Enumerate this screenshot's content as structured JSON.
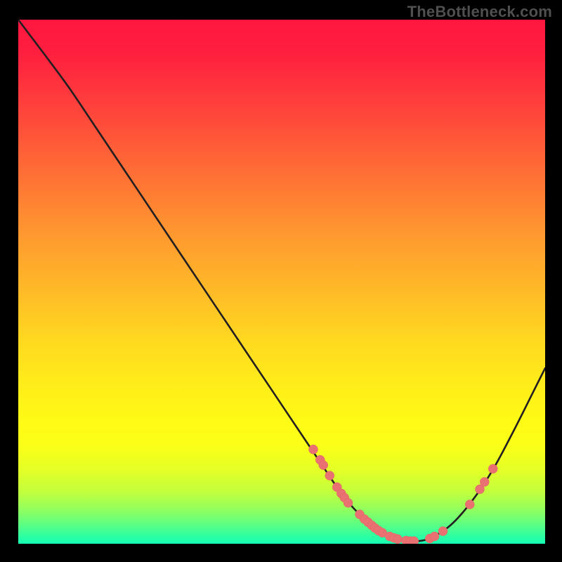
{
  "watermark": "TheBottleneck.com",
  "colors": {
    "curve_stroke": "#231f20",
    "point_fill": "#e97171",
    "point_stroke": "#e36363",
    "background": "#000000",
    "watermark": "#4f4f4f"
  },
  "chart_data": {
    "type": "line",
    "title": "",
    "xlabel": "",
    "ylabel": "",
    "xlim": [
      0,
      100
    ],
    "ylim": [
      0,
      100
    ],
    "grid": false,
    "legend": false,
    "series": [
      {
        "name": "curve",
        "x": [
          0,
          3,
          6,
          10,
          15,
          20,
          25,
          30,
          35,
          40,
          45,
          50,
          55,
          58,
          60,
          63,
          66,
          69,
          72,
          75,
          78,
          82,
          86,
          90,
          94,
          98,
          100
        ],
        "y": [
          100,
          96,
          92,
          86.5,
          79,
          71.5,
          64,
          56.5,
          49,
          41.5,
          34,
          26.5,
          19,
          14.5,
          11.5,
          7.5,
          4.5,
          2.3,
          1.0,
          0.5,
          1.0,
          3.5,
          8.0,
          14.0,
          21.5,
          29.5,
          33.5
        ]
      }
    ],
    "points": [
      {
        "x": 56.0,
        "y": 18.0
      },
      {
        "x": 57.3,
        "y": 16.0
      },
      {
        "x": 57.9,
        "y": 15.0
      },
      {
        "x": 59.1,
        "y": 13.0
      },
      {
        "x": 60.5,
        "y": 10.8
      },
      {
        "x": 61.3,
        "y": 9.6
      },
      {
        "x": 61.9,
        "y": 8.8
      },
      {
        "x": 62.6,
        "y": 7.8
      },
      {
        "x": 64.8,
        "y": 5.6
      },
      {
        "x": 65.7,
        "y": 4.7
      },
      {
        "x": 66.4,
        "y": 4.1
      },
      {
        "x": 67.1,
        "y": 3.5
      },
      {
        "x": 67.7,
        "y": 3.0
      },
      {
        "x": 68.4,
        "y": 2.5
      },
      {
        "x": 69.1,
        "y": 2.1
      },
      {
        "x": 70.5,
        "y": 1.4
      },
      {
        "x": 71.3,
        "y": 1.1
      },
      {
        "x": 72.0,
        "y": 0.9
      },
      {
        "x": 73.6,
        "y": 0.6
      },
      {
        "x": 74.4,
        "y": 0.5
      },
      {
        "x": 75.1,
        "y": 0.5
      },
      {
        "x": 78.1,
        "y": 1.0
      },
      {
        "x": 79.0,
        "y": 1.4
      },
      {
        "x": 80.6,
        "y": 2.4
      },
      {
        "x": 85.7,
        "y": 7.5
      },
      {
        "x": 87.6,
        "y": 10.4
      },
      {
        "x": 88.5,
        "y": 11.8
      },
      {
        "x": 90.1,
        "y": 14.3
      }
    ]
  }
}
